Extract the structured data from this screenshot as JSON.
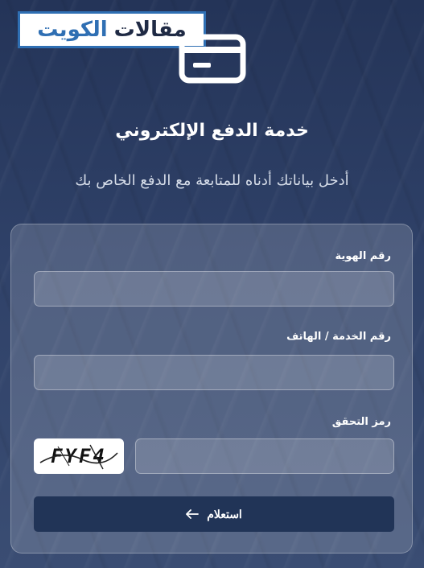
{
  "brand": {
    "logo_part1": "مقالات",
    "logo_part2": "الكويت"
  },
  "page": {
    "title": "خدمة الدفع الإلكتروني",
    "subtitle": "أدخل بياناتك أدناه للمتابعة مع الدفع الخاص بك"
  },
  "form": {
    "id_label": "رقم الهوية",
    "id_value": "",
    "service_label": "رقم الخدمة / الهاتف",
    "service_value": "",
    "captcha_label": "رمز التحقق",
    "captcha_value": "",
    "captcha_text": "FYF4",
    "submit_label": "استعلام"
  },
  "icons": {
    "header": "credit-card-icon",
    "submit": "arrow-left-icon"
  },
  "colors": {
    "background": "#2a3a5e",
    "button": "#213457",
    "logo_border": "#2f6fb3"
  }
}
